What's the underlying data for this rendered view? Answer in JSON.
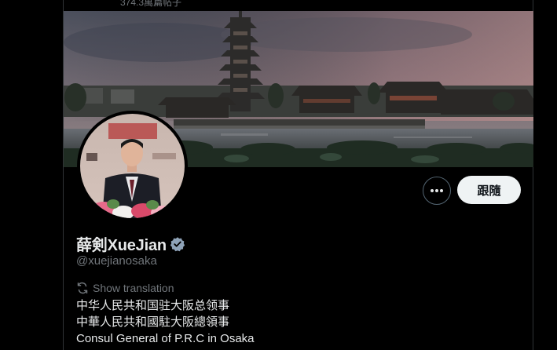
{
  "header": {
    "post_count": "374.3萬篇帖子"
  },
  "profile": {
    "display_name": "薛剣XueJian",
    "handle": "@xuejianosaka",
    "verified_badge_icon": "verified-badge-icon",
    "bio_lines": [
      "中华人民共和国驻大阪总领事",
      "中華人民共和國駐大阪總領事",
      "Consul General of P.R.C  in Osaka"
    ]
  },
  "translation": {
    "label": "Show translation",
    "icon": "translate-icon"
  },
  "actions": {
    "more_icon": "more-options-icon",
    "follow_label": "跟隨"
  },
  "colors": {
    "background": "#000000",
    "text_primary": "#e7e9ea",
    "text_secondary": "#71767b",
    "follow_bg": "#eff3f4",
    "verified_blue": "#8fa3b8"
  }
}
